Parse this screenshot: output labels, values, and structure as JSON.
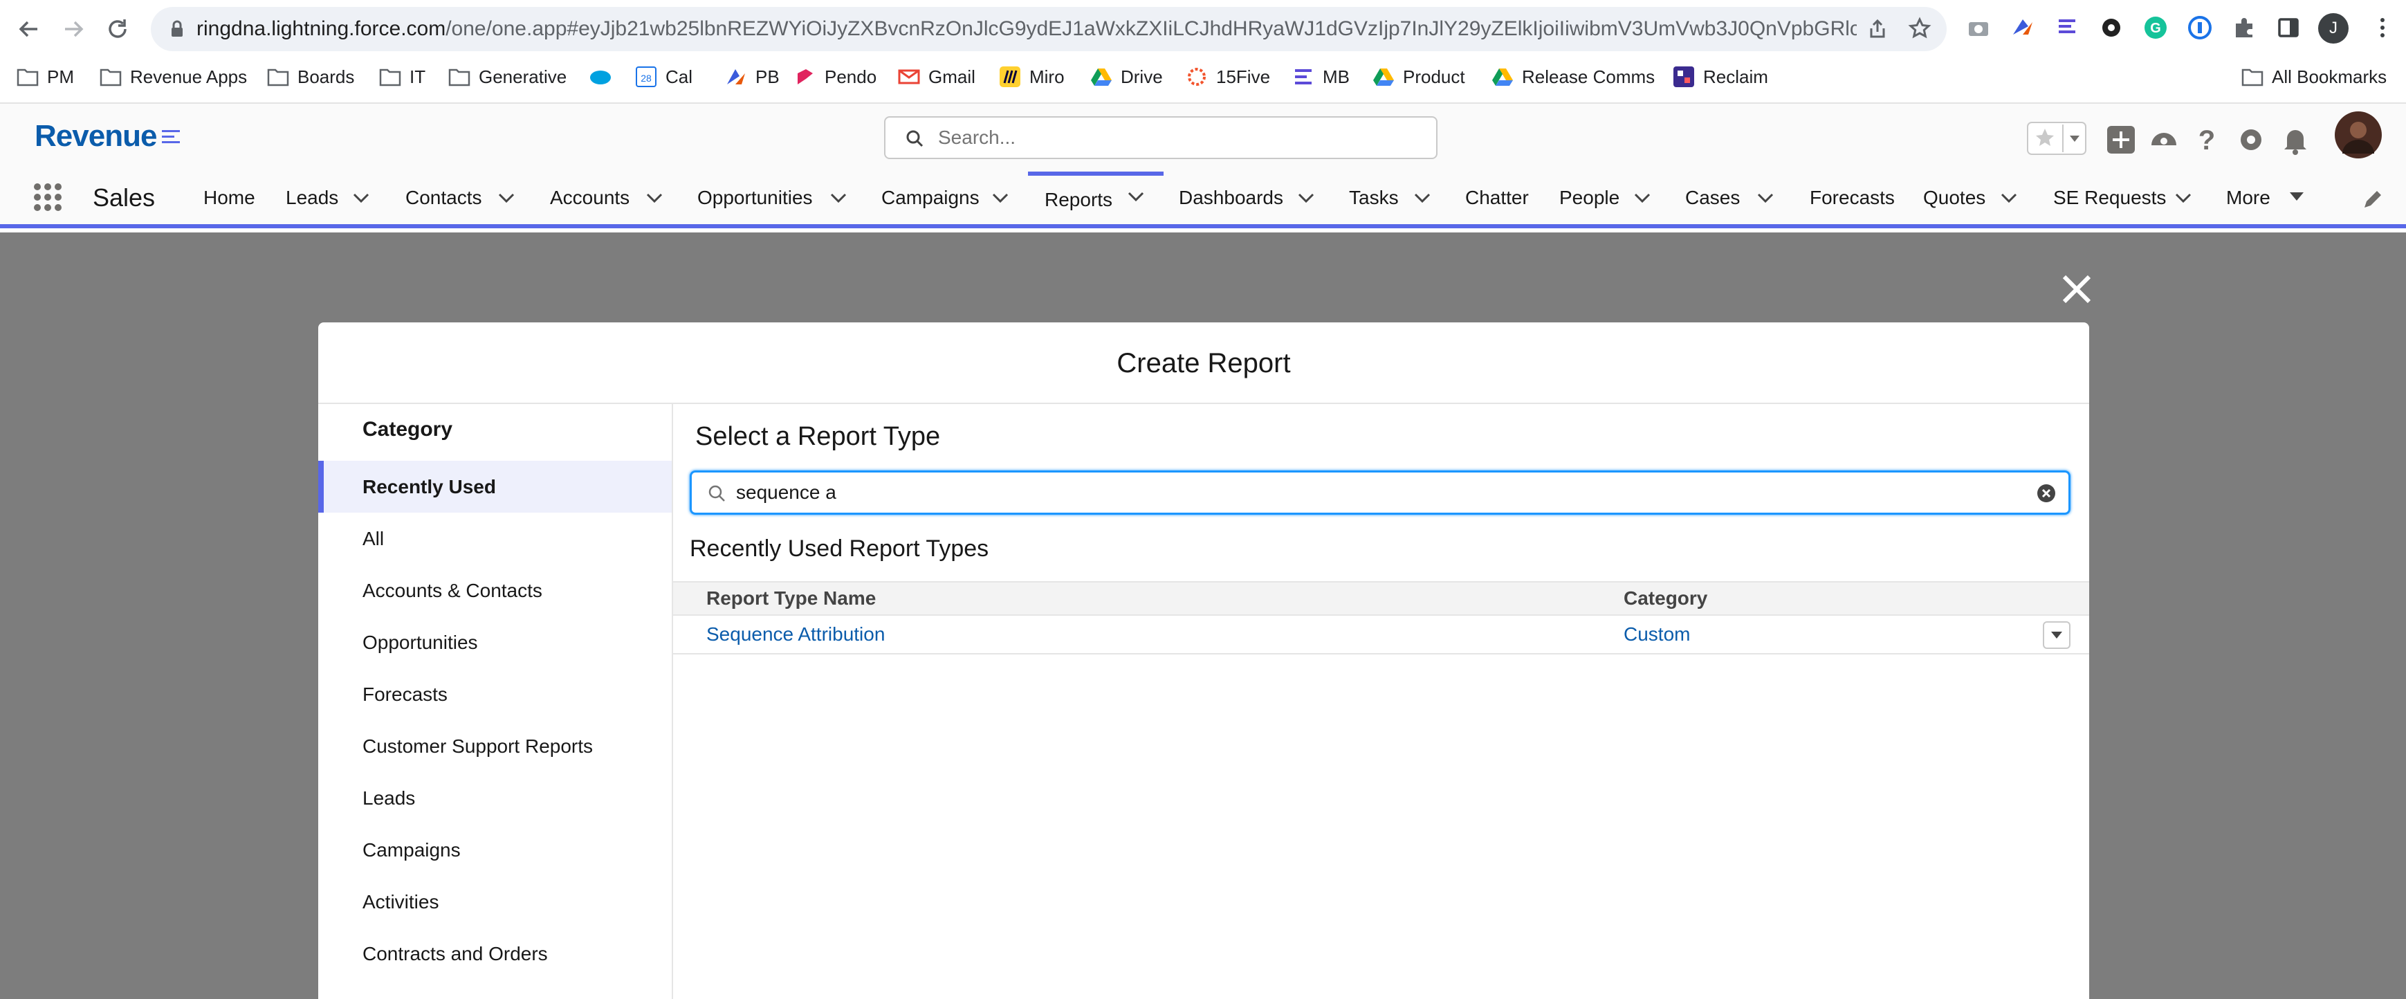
{
  "browser": {
    "url_host": "ringdna.lightning.force.com",
    "url_rest": "/one/one.app#eyJjb21wb25lbnREZWYiOiJyZXBvcnRzOnJlcG9ydEJ1aWxkZXIiLCJhdHRyaWJ1dGVzIjp7InJlY29yZElkIjoiIiwibmV3UmVwb3J0QnVpbGRlci6...",
    "profile_initial": "J",
    "bookmarks": [
      "PM",
      "Revenue Apps",
      "Boards",
      "IT",
      "Generative",
      "Cal",
      "PB",
      "Pendo",
      "Gmail",
      "Miro",
      "Drive",
      "15Five",
      "MB",
      "Product",
      "Release Comms",
      "Reclaim"
    ],
    "all_bookmarks": "All Bookmarks",
    "cal_badge": "28"
  },
  "sf": {
    "logo": "Revenue",
    "search_placeholder": "Search...",
    "app_name": "Sales",
    "nav": [
      "Home",
      "Leads",
      "Contacts",
      "Accounts",
      "Opportunities",
      "Campaigns",
      "Reports",
      "Dashboards",
      "Tasks",
      "Chatter",
      "People",
      "Cases",
      "Forecasts",
      "Quotes",
      "SE Requests",
      "More"
    ],
    "active_nav": "Reports"
  },
  "modal": {
    "title": "Create Report",
    "category_heading": "Category",
    "categories": [
      "Recently Used",
      "All",
      "Accounts & Contacts",
      "Opportunities",
      "Forecasts",
      "Customer Support Reports",
      "Leads",
      "Campaigns",
      "Activities",
      "Contracts and Orders"
    ],
    "selected_category": "Recently Used",
    "select_title": "Select a Report Type",
    "search_value": "sequence a",
    "recent_title": "Recently Used Report Types",
    "columns": [
      "Report Type Name",
      "Category"
    ],
    "rows": [
      {
        "name": "Sequence Attribution",
        "category": "Custom"
      }
    ]
  },
  "colors": {
    "accent": "#5867e8",
    "link": "#0b5cab",
    "overlay": "#7d7d7d",
    "focus": "#1b96ff"
  }
}
